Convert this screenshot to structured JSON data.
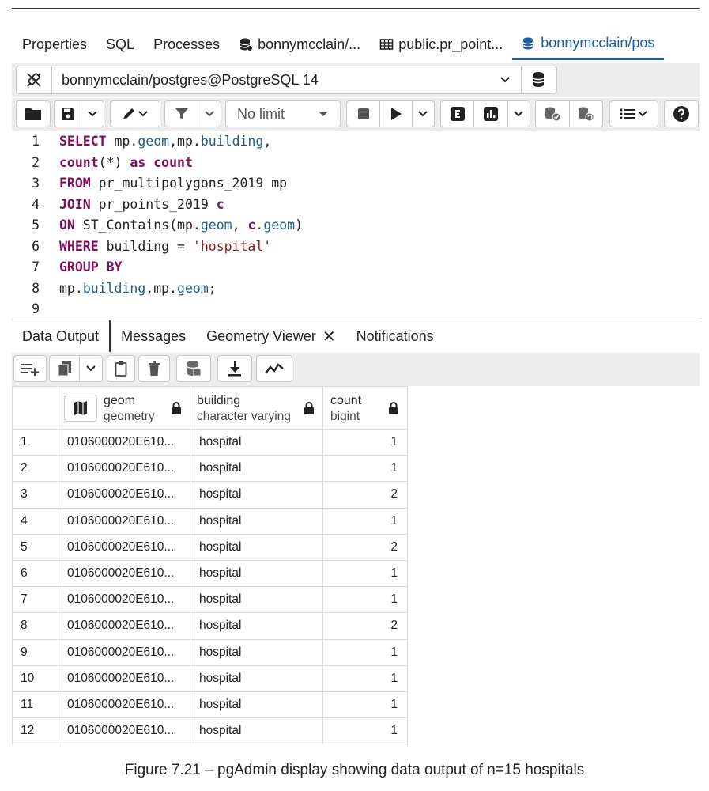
{
  "tabs": [
    {
      "label": "Properties",
      "icon": ""
    },
    {
      "label": "SQL",
      "icon": ""
    },
    {
      "label": "Processes",
      "icon": ""
    },
    {
      "label": "bonnymcclain/...",
      "icon": "database-icon"
    },
    {
      "label": "public.pr_point...",
      "icon": "table-icon"
    },
    {
      "label": "bonnymcclain/pos",
      "icon": "database-icon",
      "active": true
    }
  ],
  "connection": {
    "value": "bonnymcclain/postgres@PostgreSQL 14"
  },
  "toolbar": {
    "limit_label": "No limit"
  },
  "editor": {
    "line_numbers": [
      "1",
      "2",
      "3",
      "4",
      "5",
      "6",
      "7",
      "8",
      "9"
    ]
  },
  "results_tabs": [
    "Data Output",
    "Messages",
    "Geometry Viewer",
    "Notifications"
  ],
  "grid": {
    "columns": [
      {
        "name": "geom",
        "type": "geometry"
      },
      {
        "name": "building",
        "type": "character varying"
      },
      {
        "name": "count",
        "type": "bigint"
      }
    ],
    "rows": [
      [
        "1",
        "0106000020E610...",
        "hospital",
        "1"
      ],
      [
        "2",
        "0106000020E610...",
        "hospital",
        "1"
      ],
      [
        "3",
        "0106000020E610...",
        "hospital",
        "2"
      ],
      [
        "4",
        "0106000020E610...",
        "hospital",
        "1"
      ],
      [
        "5",
        "0106000020E610...",
        "hospital",
        "2"
      ],
      [
        "6",
        "0106000020E610...",
        "hospital",
        "1"
      ],
      [
        "7",
        "0106000020E610...",
        "hospital",
        "1"
      ],
      [
        "8",
        "0106000020E610...",
        "hospital",
        "2"
      ],
      [
        "9",
        "0106000020E610...",
        "hospital",
        "1"
      ],
      [
        "10",
        "0106000020E610...",
        "hospital",
        "1"
      ],
      [
        "11",
        "0106000020E610...",
        "hospital",
        "1"
      ],
      [
        "12",
        "0106000020E610...",
        "hospital",
        "1"
      ]
    ]
  },
  "caption": "Figure 7.21 – pgAdmin display showing data output of n=15 hospitals",
  "colors": {
    "accent": "#1a5fa6",
    "keyword": "#7a0f5a",
    "field": "#1d5e85",
    "string": "#8a1a1a",
    "toolbar_bg": "#ececec"
  }
}
